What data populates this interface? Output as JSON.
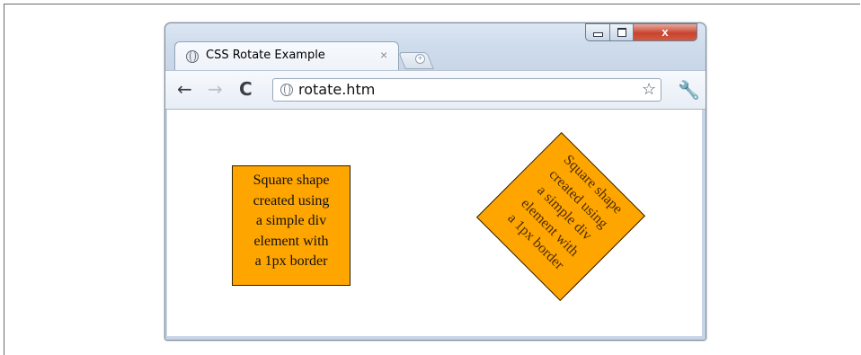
{
  "browser": {
    "tab": {
      "title": "CSS Rotate Example",
      "close_glyph": "×"
    },
    "new_tab_glyph": "+",
    "window_controls": {
      "minimize": "",
      "maximize": "",
      "close": "x"
    },
    "toolbar": {
      "back_glyph": "←",
      "forward_glyph": "→",
      "reload_glyph": "C",
      "url": "rotate.htm",
      "star_glyph": "☆",
      "wrench_glyph": "🔧"
    }
  },
  "content": {
    "plain_box_text": "Square shape\ncreated using\na simple div\nelement with\na 1px border",
    "rotated_box_text": "Square shape\ncreated using\na simple div\nelement with\na 1px border",
    "box_color": "#ffa500",
    "rotation_degrees": 45
  },
  "icons": [
    "globe-icon",
    "close-icon",
    "new-tab-icon",
    "back-arrow-icon",
    "forward-arrow-icon",
    "reload-icon",
    "star-icon",
    "wrench-icon"
  ]
}
